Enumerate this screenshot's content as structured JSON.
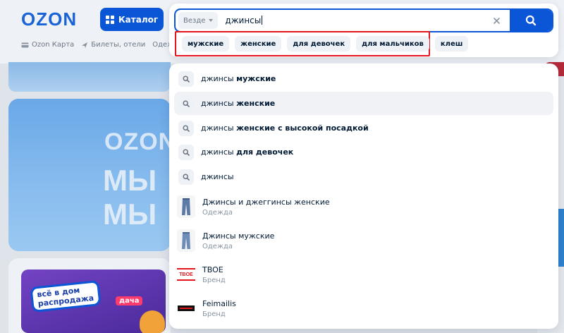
{
  "header": {
    "logo": "OZON",
    "catalog_label": "Каталог",
    "subnav": [
      "Ozon Карта",
      "Билеты, отели",
      "Одежда,"
    ]
  },
  "promo": {
    "logo": "OZON",
    "line1": "МЫ",
    "line2": "МЫ"
  },
  "dacha_card": {
    "badge_line1": "всё в дом",
    "badge_line2": "распродажа",
    "tag": "дача"
  },
  "search": {
    "scope_label": "Везде",
    "query": "джинсы",
    "chips": [
      "мужские",
      "женские",
      "для девочек",
      "для мальчиков",
      "клеш"
    ]
  },
  "suggestions": [
    {
      "prefix": "джинсы ",
      "bold": "мужские",
      "highlighted": false
    },
    {
      "prefix": "джинсы ",
      "bold": "женские",
      "highlighted": true
    },
    {
      "prefix": "джинсы ",
      "bold": "женские с высокой посадкой",
      "highlighted": false
    },
    {
      "prefix": "джинсы ",
      "bold": "для девочек",
      "highlighted": false
    },
    {
      "prefix": "джинсы",
      "bold": "",
      "highlighted": false
    }
  ],
  "products": [
    {
      "name": "Джинсы и джеггинсы женские",
      "category": "Одежда",
      "icon": "jeans-thumbnail"
    },
    {
      "name": "Джинсы мужские",
      "category": "Одежда",
      "icon": "jeans-thumbnail"
    }
  ],
  "brands": [
    {
      "name": "TBOE",
      "category": "Бренд",
      "logo_text": "TBOE",
      "color": "#e5141f"
    },
    {
      "name": "Feimailis",
      "category": "Бренд",
      "logo_text": "",
      "color": "#111111"
    }
  ],
  "colors": {
    "accent": "#0a56d6",
    "chip_outline": "#e5141f",
    "text": "#001a34",
    "muted": "#8a94a0"
  }
}
